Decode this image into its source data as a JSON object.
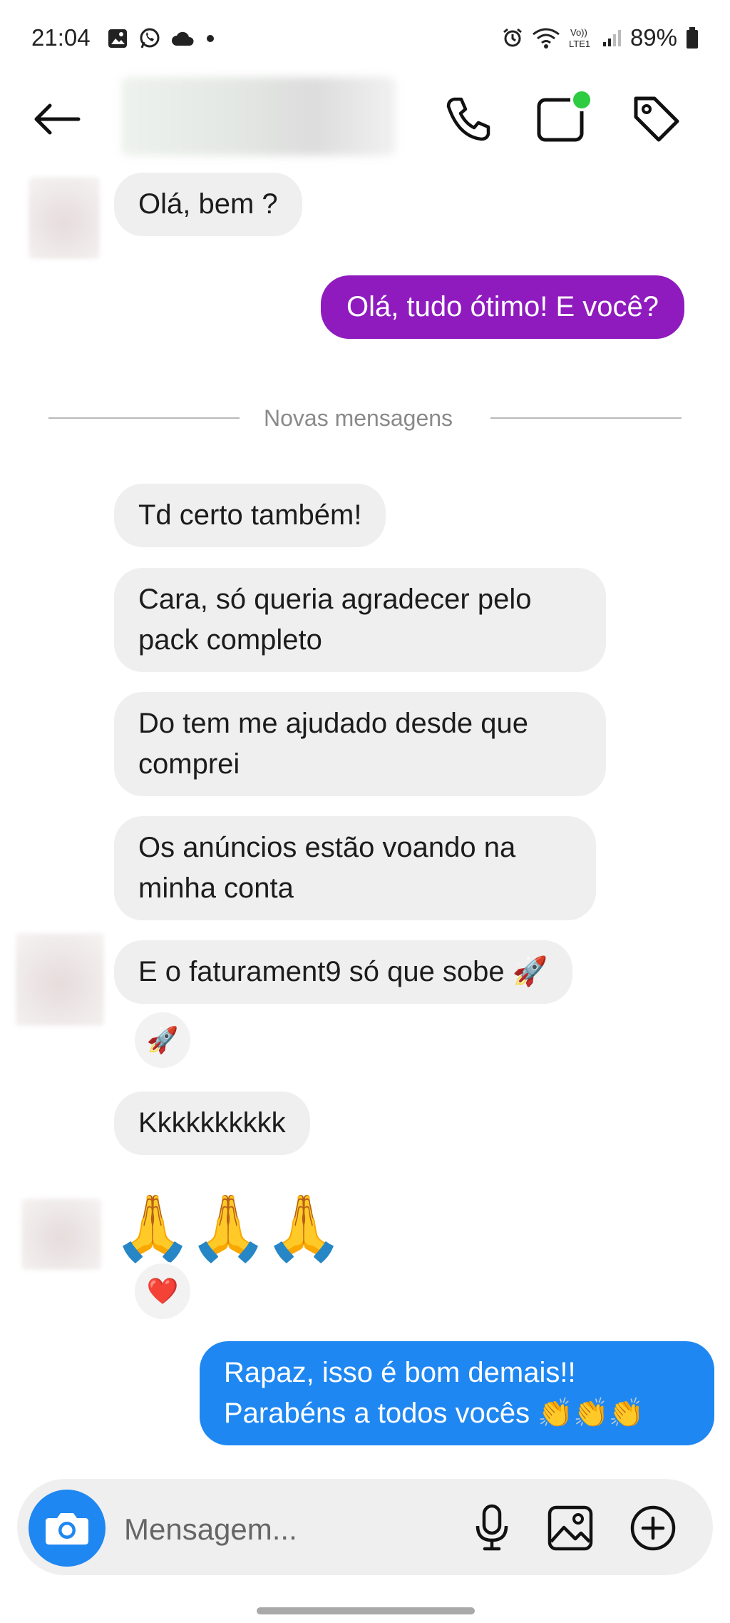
{
  "status_bar": {
    "time": "21:04",
    "battery": "89%",
    "left_icons": [
      "gallery-icon",
      "whatsapp-icon",
      "cloud-icon",
      "dot-icon"
    ],
    "right_icons": [
      "alarm-icon",
      "wifi-icon",
      "volte-icon",
      "signal-icon",
      "battery-icon"
    ],
    "volte_label": "Vo))\nLTE1"
  },
  "header": {
    "icons": [
      "back-arrow-icon",
      "phone-icon",
      "video-icon",
      "tag-icon"
    ],
    "online_indicator_color": "#2ecc40"
  },
  "messages": [
    {
      "side": "left",
      "text": "Olá, bem ?"
    },
    {
      "side": "right",
      "text": "Olá, tudo ótimo! E você?",
      "color": "#8f1bbf"
    },
    {
      "side": "left",
      "text": "Td certo também!"
    },
    {
      "side": "left",
      "text": "Cara, só queria agradecer pelo pack completo"
    },
    {
      "side": "left",
      "text": "Do tem me ajudado desde que comprei"
    },
    {
      "side": "left",
      "text": "Os anúncios estão voando na minha conta"
    },
    {
      "side": "left",
      "text": "E o faturament9 só que sobe 🚀",
      "reaction": "🚀"
    },
    {
      "side": "left",
      "text": "Kkkkkkkkkk"
    },
    {
      "side": "left",
      "text": "🙏🙏🙏",
      "reaction": "❤️"
    },
    {
      "side": "right",
      "text": "Rapaz, isso é bom demais!! Parabéns a todos vocês 👏👏👏",
      "color": "#1f87f2"
    }
  ],
  "divider": {
    "label": "Novas mensagens"
  },
  "composer": {
    "placeholder": "Mensagem...",
    "icons": [
      "camera-icon",
      "microphone-icon",
      "image-icon",
      "plus-circle-icon"
    ]
  }
}
